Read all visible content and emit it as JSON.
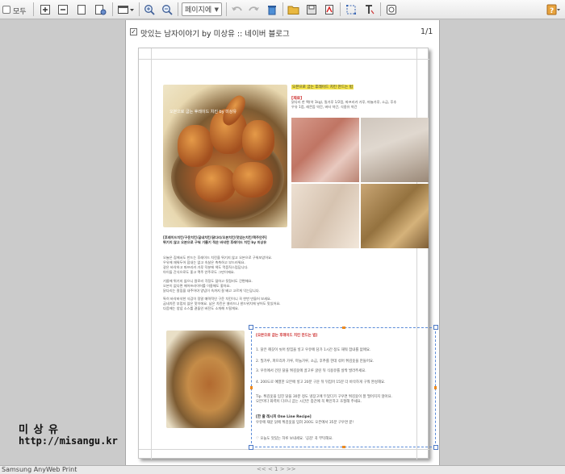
{
  "toolbar": {
    "select_all_label": "모두",
    "fit_select_value": "페이지에 맞춤"
  },
  "document": {
    "title": "맛있는 남자이야기 by 미상유 :: 네이버 블로그",
    "page_count": "1/1"
  },
  "article": {
    "photo_caption": "오븐으로 굽는 후레이드 치킨 by 미상유",
    "highlight_heading": "오븐으로 굽는 후레이드 치킨 만드는 법",
    "red_label": "[재료]",
    "intro_lines": [
      "닭다리 한 팩(약 1kg), 밀가루 1/2컵, 파프리카 가루, 마늘가루, 소금, 후추",
      "우유 1컵, 레몬즙 약간, 버터 약간, 식용유 약간"
    ],
    "caption_bold": [
      "[후레이드치킨/구운치킨/굽네치킨/닭다리/오븐치킨/맛있는치킨/맥주안주]",
      "튀기지 않고 오븐으로 구워 기름기 적은 바삭한 후레이드 치킨 by 미상유"
    ],
    "body_paragraphs": [
      "오늘은 집에서도 만드는 후레이드 치킨을 튀기지 않고 오븐으로 구워보았어요.\n우유에 재워두어 잡내는 없고 속살은 촉촉하고 부드러워요.\n겉은 바삭하고 파프리카 가루 덕분에 색도 먹음직스럽답니다.\n아이들 간식으로도 좋고 맥주 안주로도 그만이에요.",
      "기름에 튀기지 않으니 칼로리 걱정도 덜하고 뒷정리도 간편해요.\n오븐이 없다면 에어프라이어를 이용해도 좋아요.\n닭다리는 칼집을 내주어야 양념이 속까지 잘 배고 고르게 익는답니다.",
      "특히 바삭바삭한 식감이 정말 매력적인 구운 치킨이니 꼭 한번 만들어 보세요.\n굽네치킨 부럽지 않은 맛이에요. 남은 치킨은 샐러드나 샌드위치에 넣어도 맛있어요.\n다음에는 양념 소스를 곁들인 버전도 소개해 드릴게요."
    ],
    "recipe_title": "[오븐으로 굽는 후레이드 치킨 만드는 법]",
    "recipe_steps": [
      "1. 닭은 깨끗이 씻어 칼집을 넣고 우유에 담가 1시간 정도 재워 잡내를 없애요.",
      "2. 밀가루, 파프리카 가루, 마늘가루, 소금, 후추를 한데 섞어 튀김옷을 만들어요.",
      "3. 우유에서 건진 닭을 튀김옷에 골고루 굴린 뒤 식용유를 살짝 발라주세요.",
      "4. 200도로 예열한 오븐에 넣고 20분 구운 뒤 뒤집어 15분 더 바삭하게 구워 완성해요."
    ],
    "recipe_tip": "Tip. 튀김옷을 입힌 닭을 30분 정도 냉장고에 두었다가 구우면 튀김옷이 잘 떨어지지 않아요.\n       오븐마다 화력이 다르니 굽는 시간은 중간에 꼭 확인하고 조절해 주세요.",
    "one_line_title": "[한 줄 레시피 One Line Recipe]",
    "one_line_text": "우유에 재운 닭에 튀김옷을 입혀 200도 오븐에서 35분 구우면 끝!",
    "closing": "♡ 오늘도 맛있는 하루 보내세요. '공감' 꾹 부탁해요."
  },
  "watermark": {
    "name": "미 상 유",
    "url": "http://misangu.kr"
  },
  "status": {
    "app_name": "Samsung AnyWeb Print",
    "pager": "<< < 1 > >>"
  }
}
